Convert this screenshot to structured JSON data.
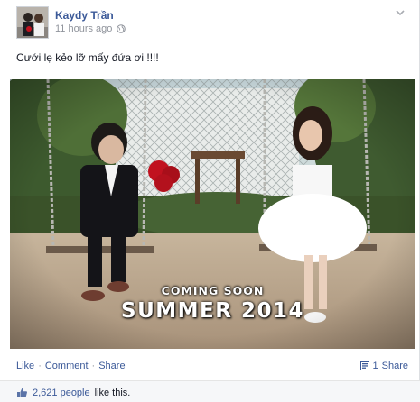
{
  "post": {
    "author": "Kaydy Trần",
    "time": "11 hours ago",
    "caption": "Cưới lẹ kẻo lỡ mấy đứa ơi !!!!",
    "photo_text_line1": "COMING SOON",
    "photo_text_line2": "SUMMER 2014"
  },
  "actions": {
    "like": "Like",
    "comment": "Comment",
    "share": "Share",
    "separator": "·"
  },
  "shares": {
    "count": "1",
    "label": "Share"
  },
  "likes": {
    "count_people": "2,621 people",
    "suffix": "like this."
  },
  "icons": {
    "privacy": "globe-icon",
    "menu": "chevron-down-icon",
    "shares": "share-icon",
    "likes": "thumbs-up-icon"
  },
  "colors": {
    "link": "#3b5998",
    "meta": "#90949c",
    "text": "#141823"
  }
}
